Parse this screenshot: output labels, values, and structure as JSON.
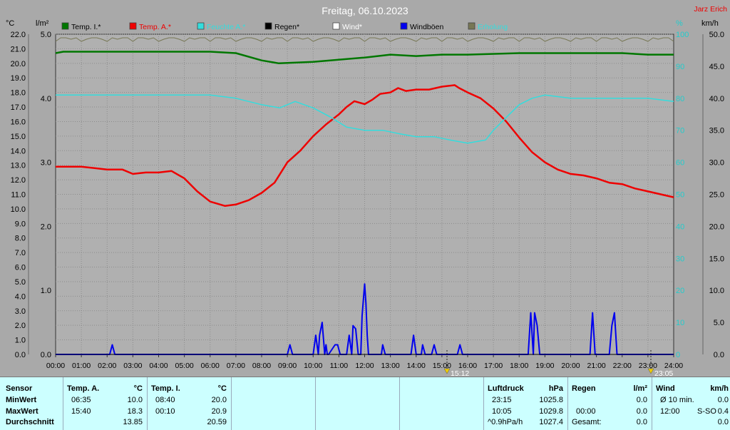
{
  "title": "Freitag, 06.10.2023",
  "station": "Jarz Erich",
  "left_units": {
    "temp": "°C",
    "rain": "l/m²"
  },
  "right_units": {
    "hum": "%",
    "wind": "km/h"
  },
  "legend": [
    {
      "label": "Temp. I.*",
      "color": "#007700"
    },
    {
      "label": "Temp. A.*",
      "color": "#ee0000"
    },
    {
      "label": "Feuchte A.*",
      "color": "#33dddd"
    },
    {
      "label": "Regen*",
      "color": "#000000"
    },
    {
      "label": "Wind*",
      "color": "#ffffff"
    },
    {
      "label": "Windböen",
      "color": "#0000ee"
    },
    {
      "label": "Erholung",
      "color": "#777755"
    }
  ],
  "markers": [
    {
      "label": "15:12"
    },
    {
      "label": "23:05"
    }
  ],
  "chart_data": {
    "type": "line",
    "title": "Freitag, 06.10.2023",
    "x_label": "",
    "x_ticks": [
      "00:00",
      "01:00",
      "02:00",
      "03:00",
      "04:00",
      "05:00",
      "06:00",
      "07:00",
      "08:00",
      "09:00",
      "10:00",
      "11:00",
      "12:00",
      "13:00",
      "14:00",
      "15:00",
      "16:00",
      "17:00",
      "18:00",
      "19:00",
      "20:00",
      "21:00",
      "22:00",
      "23:00",
      "24:00"
    ],
    "axes": {
      "temp": {
        "min": 0,
        "max": 22,
        "ticks": [
          "0.0",
          "1.0",
          "2.0",
          "3.0",
          "4.0",
          "5.0",
          "6.0",
          "7.0",
          "8.0",
          "9.0",
          "10.0",
          "11.0",
          "12.0",
          "13.0",
          "14.0",
          "15.0",
          "16.0",
          "17.0",
          "18.0",
          "19.0",
          "20.0",
          "21.0",
          "22.0"
        ]
      },
      "rain": {
        "min": 0,
        "max": 5,
        "ticks": [
          "0.0",
          "1.0",
          "2.0",
          "3.0",
          "4.0",
          "5.0"
        ]
      },
      "hum": {
        "min": 0,
        "max": 100,
        "ticks": [
          "0",
          "10",
          "20",
          "30",
          "40",
          "50",
          "60",
          "70",
          "80",
          "90",
          "100"
        ]
      },
      "wind": {
        "min": 0,
        "max": 50,
        "ticks": [
          "0.0",
          "5.0",
          "10.0",
          "15.0",
          "20.0",
          "25.0",
          "30.0",
          "35.0",
          "40.0",
          "45.0",
          "50.0"
        ]
      }
    },
    "series": [
      {
        "name": "Temp. I.*",
        "axis": "temp",
        "color": "#007700",
        "x": [
          0,
          0.3,
          2,
          4,
          6,
          7,
          8,
          8.67,
          10,
          12,
          13,
          14,
          15,
          16,
          18,
          20,
          22,
          23,
          24
        ],
        "y": [
          20.7,
          20.8,
          20.8,
          20.8,
          20.8,
          20.7,
          20.2,
          20.0,
          20.1,
          20.4,
          20.6,
          20.5,
          20.6,
          20.6,
          20.7,
          20.7,
          20.7,
          20.6,
          20.6
        ]
      },
      {
        "name": "Temp. A.*",
        "axis": "temp",
        "color": "#ee0000",
        "x": [
          0,
          1,
          2,
          2.6,
          3,
          3.5,
          4,
          4.5,
          5,
          5.5,
          6,
          6.58,
          7,
          7.5,
          8,
          8.5,
          9,
          9.5,
          10,
          10.5,
          11,
          11.3,
          11.6,
          12,
          12.3,
          12.6,
          13,
          13.3,
          13.6,
          14,
          14.5,
          15,
          15.5,
          15.67,
          16,
          16.5,
          17,
          17.5,
          18,
          18.5,
          19,
          19.5,
          20,
          20.5,
          21,
          21.5,
          22,
          22.5,
          23,
          23.5,
          24
        ],
        "y": [
          12.9,
          12.9,
          12.7,
          12.7,
          12.4,
          12.5,
          12.5,
          12.6,
          12.1,
          11.2,
          10.5,
          10.2,
          10.3,
          10.6,
          11.1,
          11.8,
          13.2,
          14.0,
          15.0,
          15.8,
          16.5,
          17.0,
          17.4,
          17.2,
          17.5,
          17.9,
          18.0,
          18.3,
          18.1,
          18.2,
          18.2,
          18.4,
          18.5,
          18.3,
          18.0,
          17.6,
          16.9,
          16.0,
          14.9,
          13.9,
          13.2,
          12.7,
          12.4,
          12.3,
          12.1,
          11.8,
          11.7,
          11.4,
          11.2,
          11.0,
          10.8
        ]
      },
      {
        "name": "Feuchte A.*",
        "axis": "hum",
        "color": "#33dddd",
        "x": [
          0,
          1,
          2,
          3,
          4,
          5,
          6,
          7,
          7.5,
          8,
          8.7,
          9.3,
          10,
          10.7,
          11.3,
          12,
          12.7,
          13.3,
          14,
          14.7,
          15.3,
          16,
          16.7,
          17,
          17.5,
          18,
          18.5,
          19,
          20,
          21,
          22,
          23,
          24
        ],
        "y": [
          81,
          81,
          81,
          81,
          81,
          81,
          81,
          80,
          79,
          78,
          77,
          79,
          77,
          74,
          71,
          70,
          70,
          69,
          68,
          68,
          67,
          66,
          67,
          70,
          74,
          78,
          80,
          81,
          80,
          80,
          80,
          80,
          79
        ]
      },
      {
        "name": "Windböen",
        "axis": "wind",
        "color": "#0000ee",
        "x": [
          0,
          2.1,
          2.2,
          2.3,
          9.0,
          9.1,
          9.2,
          10.0,
          10.1,
          10.2,
          10.25,
          10.35,
          10.45,
          10.5,
          10.55,
          10.6,
          10.85,
          10.95,
          11.05,
          11.3,
          11.4,
          11.5,
          11.55,
          11.65,
          11.75,
          11.85,
          11.9,
          12.0,
          12.05,
          12.1,
          12.15,
          12.65,
          12.7,
          12.8,
          13.8,
          13.9,
          14.0,
          14.2,
          14.25,
          14.35,
          14.6,
          14.7,
          14.8,
          15.6,
          15.7,
          15.8,
          18.35,
          18.45,
          18.55,
          18.6,
          18.7,
          18.8,
          18.9,
          20.75,
          20.85,
          20.95,
          21.5,
          21.6,
          21.7,
          21.8,
          24
        ],
        "y": [
          0,
          0,
          1.5,
          0,
          0,
          1.5,
          0,
          0,
          3.0,
          0,
          3.0,
          5.0,
          0,
          1.5,
          0,
          0,
          1.5,
          1.5,
          0,
          0,
          3.0,
          0,
          4.5,
          4.0,
          0,
          0,
          6.0,
          11.0,
          8.0,
          3.0,
          0,
          0,
          1.5,
          0,
          0,
          3.0,
          0,
          0,
          1.5,
          0,
          0,
          1.5,
          0,
          0,
          1.5,
          0,
          0,
          6.5,
          0,
          6.5,
          4.5,
          0,
          0,
          0,
          6.5,
          0,
          0,
          4.5,
          6.5,
          0,
          0
        ]
      }
    ],
    "rain_total_line": {
      "axis": "rain",
      "value": 0.0
    },
    "grid": true,
    "legend_position": "top"
  },
  "table": {
    "sensor": {
      "h": "Sensor",
      "rows": [
        "MinWert",
        "MaxWert",
        "Durchschnitt"
      ]
    },
    "tempA": {
      "h": "Temp. A.",
      "unit": "°C",
      "times": [
        "06:35",
        "15:40",
        ""
      ],
      "vals": [
        "10.0",
        "18.3",
        "13.85"
      ]
    },
    "tempI": {
      "h": "Temp. I.",
      "unit": "°C",
      "times": [
        "08:40",
        "00:10",
        ""
      ],
      "vals": [
        "20.0",
        "20.9",
        "20.59"
      ]
    },
    "pressure": {
      "h": "Luftdruck",
      "unit": "hPa",
      "times": [
        "23:15",
        "10:05",
        "^0.9hPa/h"
      ],
      "vals": [
        "1025.8",
        "1029.8",
        "1027.4"
      ]
    },
    "rain": {
      "h": "Regen",
      "unit": "l/m²",
      "times": [
        "",
        "00:00",
        "Gesamt:"
      ],
      "vals": [
        "0.0",
        "0.0",
        "0.0"
      ]
    },
    "wind": {
      "h": "Wind",
      "unit": "km/h",
      "times": [
        "Ø 10 min.",
        "12:00",
        ""
      ],
      "mid": [
        "",
        "S-SO",
        ""
      ],
      "vals": [
        "0.0",
        "0.4",
        "0.0"
      ]
    }
  }
}
